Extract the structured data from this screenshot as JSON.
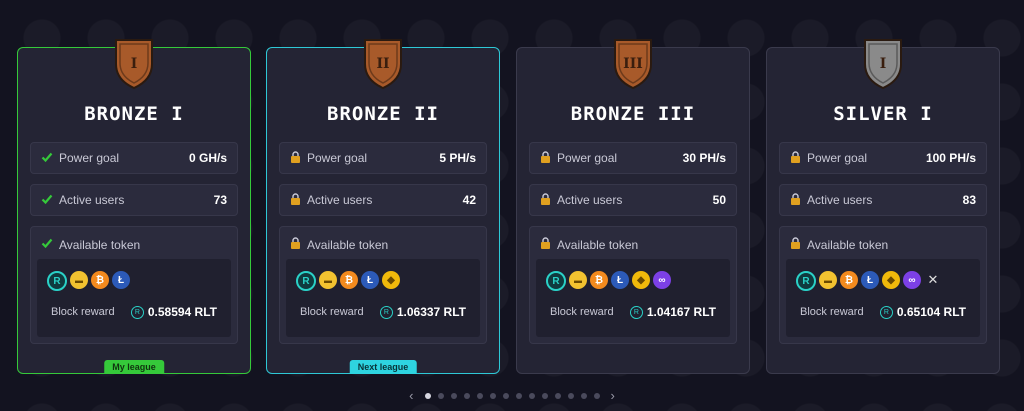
{
  "cards": [
    {
      "name": "BRONZE I",
      "numeral": "I",
      "shield_color": "#a85a2a",
      "power_label": "Power goal",
      "power_value": "0 GH/s",
      "users_label": "Active users",
      "users_value": "73",
      "token_label": "Available token",
      "tokens": [
        "rlt",
        "hmt",
        "btc",
        "ltc"
      ],
      "reward_label": "Block reward",
      "reward_value": "0.58594 RLT",
      "status": "check",
      "tag": "My league"
    },
    {
      "name": "BRONZE II",
      "numeral": "II",
      "shield_color": "#a85a2a",
      "power_label": "Power goal",
      "power_value": "5 PH/s",
      "users_label": "Active users",
      "users_value": "42",
      "token_label": "Available token",
      "tokens": [
        "rlt",
        "hmt",
        "btc",
        "ltc",
        "bnb"
      ],
      "reward_label": "Block reward",
      "reward_value": "1.06337 RLT",
      "status": "lock",
      "tag": "Next league"
    },
    {
      "name": "BRONZE III",
      "numeral": "III",
      "shield_color": "#a85a2a",
      "power_label": "Power goal",
      "power_value": "30 PH/s",
      "users_label": "Active users",
      "users_value": "50",
      "token_label": "Available token",
      "tokens": [
        "rlt",
        "hmt",
        "btc",
        "ltc",
        "bnb",
        "pol"
      ],
      "reward_label": "Block reward",
      "reward_value": "1.04167 RLT",
      "status": "lock",
      "tag": ""
    },
    {
      "name": "SILVER I",
      "numeral": "I",
      "shield_color": "#8a8a8a",
      "power_label": "Power goal",
      "power_value": "100 PH/s",
      "users_label": "Active users",
      "users_value": "83",
      "token_label": "Available token",
      "tokens": [
        "rlt",
        "hmt",
        "btc",
        "ltc",
        "bnb",
        "pol",
        "x"
      ],
      "reward_label": "Block reward",
      "reward_value": "0.65104 RLT",
      "status": "lock",
      "tag": ""
    }
  ],
  "pager": {
    "count": 14,
    "active": 0,
    "prev": "‹",
    "next": "›"
  },
  "token_glyphs": {
    "rlt": "R",
    "hmt": "▬",
    "btc": "₿",
    "ltc": "Ł",
    "bnb": "◆",
    "pol": "∞",
    "x": "✕"
  },
  "colors": {
    "my_league": "#35c93a",
    "next_league": "#2ec8d6",
    "rlt_accent": "#2ad1c7"
  }
}
